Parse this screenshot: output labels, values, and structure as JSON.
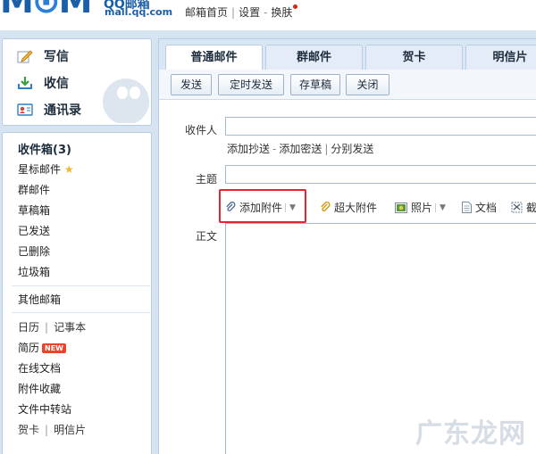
{
  "logo": {
    "wordmark": "M",
    "cn": "QQ邮箱",
    "url": "mail.qq.com"
  },
  "topnav": {
    "home": "邮箱首页",
    "settings": "设置",
    "skin": "换肤"
  },
  "sidebar_top": {
    "compose": "写信",
    "inbox": "收信",
    "contacts": "通讯录"
  },
  "folders": {
    "inbox": "收件箱(3)",
    "starred": "星标邮件",
    "group": "群邮件",
    "drafts": "草稿箱",
    "sent": "已发送",
    "deleted": "已删除",
    "trash": "垃圾箱",
    "other": "其他邮箱",
    "calendar": "日历",
    "notes": "记事本",
    "resume": "简历",
    "resume_badge": "NEW",
    "docs": "在线文档",
    "attachments": "附件收藏",
    "transfer": "文件中转站",
    "card": "贺卡",
    "postcard": "明信片"
  },
  "tabs": [
    "普通邮件",
    "群邮件",
    "贺卡",
    "明信片"
  ],
  "toolbar": {
    "send": "发送",
    "schedule": "定时发送",
    "save": "存草稿",
    "close": "关闭"
  },
  "form": {
    "to_label": "收件人",
    "add_cc": "添加抄送",
    "add_bcc": "添加密送",
    "separate": "分别发送",
    "dash": "-",
    "subject_label": "主题",
    "body_label": "正文"
  },
  "attach_bar": {
    "add_attachment": "添加附件",
    "large_attachment": "超大附件",
    "photo": "照片",
    "doc": "文档",
    "screenshot": "截屏"
  },
  "watermark": "广东龙网",
  "colors": {
    "accent": "#1a5fa8",
    "highlight": "#e8232a",
    "badge": "#e8452c"
  }
}
